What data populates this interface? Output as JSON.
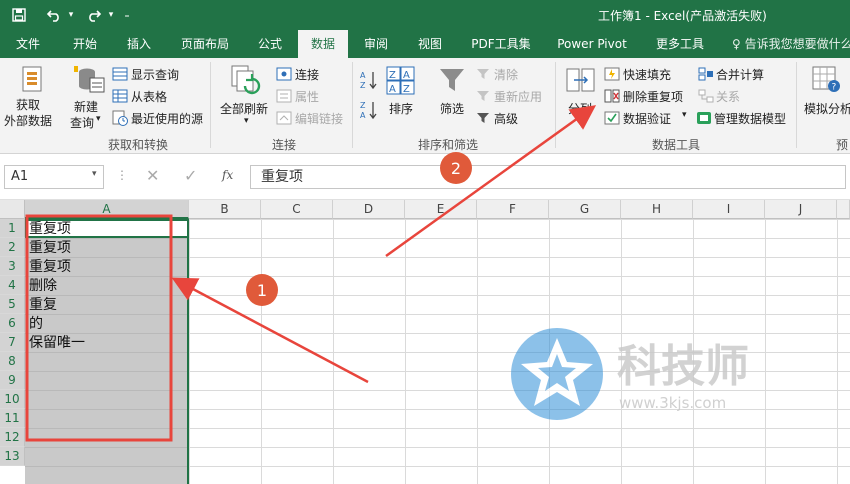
{
  "title_bar": {
    "save_icon": "save-icon",
    "undo_icon": "undo-icon",
    "redo_icon": "redo-icon",
    "customize_icon": "customize-qat-icon",
    "document_title": "工作簿1 - Excel(产品激活失败)"
  },
  "tabs": [
    "文件",
    "开始",
    "插入",
    "页面布局",
    "公式",
    "数据",
    "审阅",
    "视图",
    "PDF工具集",
    "Power Pivot",
    "更多工具"
  ],
  "active_tab": "数据",
  "tell_me": "♀ 告诉我您想要做什么",
  "ribbon": {
    "get_transform": {
      "get_external_line1": "获取",
      "get_external_line2": "外部数据",
      "new_query_line1": "新建",
      "new_query_line2": "查询",
      "show_queries": "显示查询",
      "from_table": "从表格",
      "recent_sources": "最近使用的源",
      "label": "获取和转换"
    },
    "connections": {
      "refresh_all": "全部刷新",
      "connections": "连接",
      "properties": "属性",
      "edit_links": "编辑链接",
      "label": "连接"
    },
    "sort_filter": {
      "sort_az": "A→Z",
      "sort_za": "Z→A",
      "sort": "排序",
      "filter": "筛选",
      "clear": "清除",
      "reapply": "重新应用",
      "advanced": "高级",
      "label": "排序和筛选"
    },
    "data_tools": {
      "text_to_columns": "分列",
      "flash_fill": "快速填充",
      "remove_duplicates": "删除重复项",
      "data_validation": "数据验证",
      "consolidate": "合并计算",
      "relationships": "关系",
      "manage_model": "管理数据模型",
      "label": "数据工具"
    },
    "forecast": {
      "what_if": "模拟分析",
      "label": "预"
    }
  },
  "formula_bar": {
    "name_box": "A1",
    "fx": "fx",
    "value": "重复项"
  },
  "grid": {
    "columns": [
      "A",
      "B",
      "C",
      "D",
      "E",
      "F",
      "G",
      "H",
      "I",
      "J"
    ],
    "rows": [
      "1",
      "2",
      "3",
      "4",
      "5",
      "6",
      "7",
      "8",
      "9",
      "10",
      "11",
      "12",
      "13"
    ],
    "column_a_values": [
      "重复项",
      "重复项",
      "重复项",
      "删除",
      "重复",
      "的",
      "保留唯一"
    ]
  },
  "annotations": {
    "marker_1": "1",
    "marker_2": "2",
    "color": "#e8453c"
  },
  "watermark": {
    "brand": "科技师",
    "url": "www.3kjs.com"
  },
  "colors": {
    "excel_green": "#217346",
    "selection_gray": "#c9c9c9"
  }
}
